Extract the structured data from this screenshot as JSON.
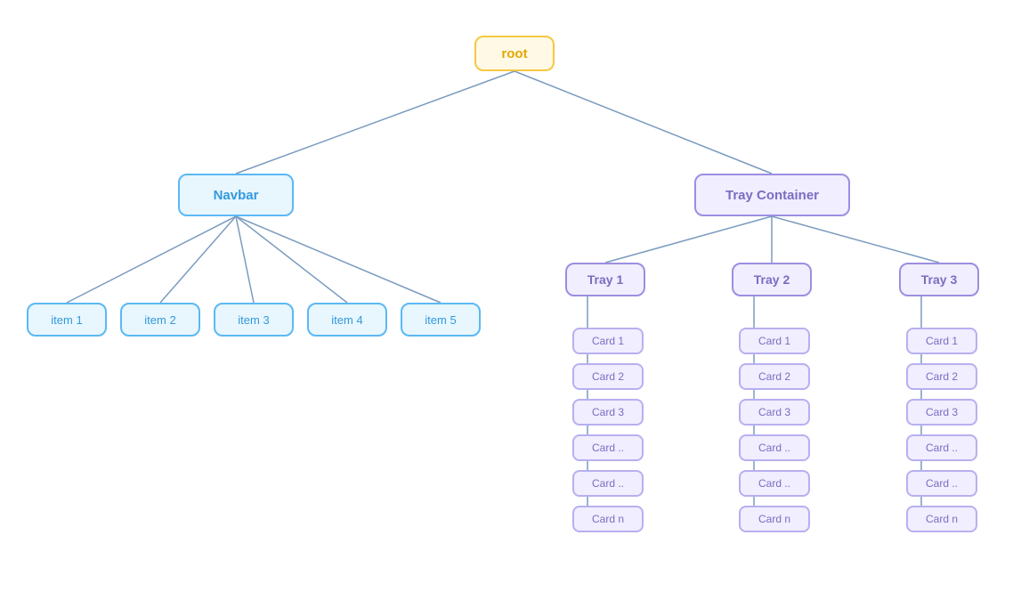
{
  "root": {
    "label": "root"
  },
  "navbar": {
    "label": "Navbar"
  },
  "tray_container": {
    "label": "Tray Container"
  },
  "items": [
    {
      "label": "item 1"
    },
    {
      "label": "item 2"
    },
    {
      "label": "item 3"
    },
    {
      "label": "item 4"
    },
    {
      "label": "item 5"
    }
  ],
  "trays": [
    {
      "label": "Tray 1"
    },
    {
      "label": "Tray 2"
    },
    {
      "label": "Tray 3"
    }
  ],
  "tray1_cards": [
    {
      "label": "Card 1"
    },
    {
      "label": "Card 2"
    },
    {
      "label": "Card 3"
    },
    {
      "label": "Card .."
    },
    {
      "label": "Card .."
    },
    {
      "label": "Card n"
    }
  ],
  "tray2_cards": [
    {
      "label": "Card 1"
    },
    {
      "label": "Card 2"
    },
    {
      "label": "Card 3"
    },
    {
      "label": "Card .."
    },
    {
      "label": "Card .."
    },
    {
      "label": "Card n"
    }
  ],
  "tray3_cards": [
    {
      "label": "Card 1"
    },
    {
      "label": "Card 2"
    },
    {
      "label": "Card 3"
    },
    {
      "label": "Card .."
    },
    {
      "label": "Card .."
    },
    {
      "label": "Card n"
    }
  ],
  "colors": {
    "line": "#7a9bbf",
    "root_border": "#f5c842",
    "navbar_border": "#5bb8f5",
    "tray_border": "#9b8fe0"
  }
}
